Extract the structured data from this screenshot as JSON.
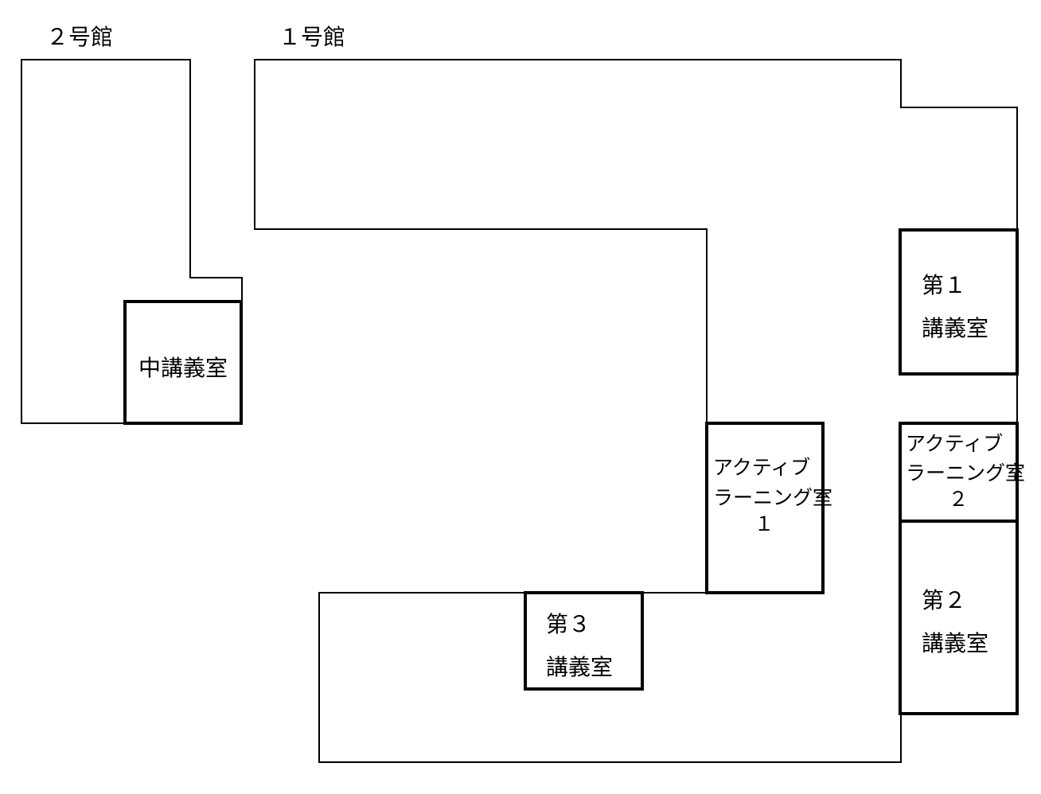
{
  "buildings": {
    "bldg2": {
      "label": "２号館"
    },
    "bldg1": {
      "label": "１号館"
    }
  },
  "rooms": {
    "middle_lecture": {
      "lines": [
        "中講義室"
      ]
    },
    "lecture_1": {
      "lines": [
        "第１",
        "講義室"
      ]
    },
    "active_learning_1": {
      "lines": [
        "アクティブ",
        "ラーニング室",
        "１"
      ]
    },
    "active_learning_2": {
      "lines": [
        "アクティブ",
        "ラーニング室",
        "２"
      ]
    },
    "lecture_2": {
      "lines": [
        "第２",
        "講義室"
      ]
    },
    "lecture_3": {
      "lines": [
        "第３",
        "講義室"
      ]
    }
  },
  "colors": {
    "line": "#000000",
    "background": "#ffffff"
  }
}
